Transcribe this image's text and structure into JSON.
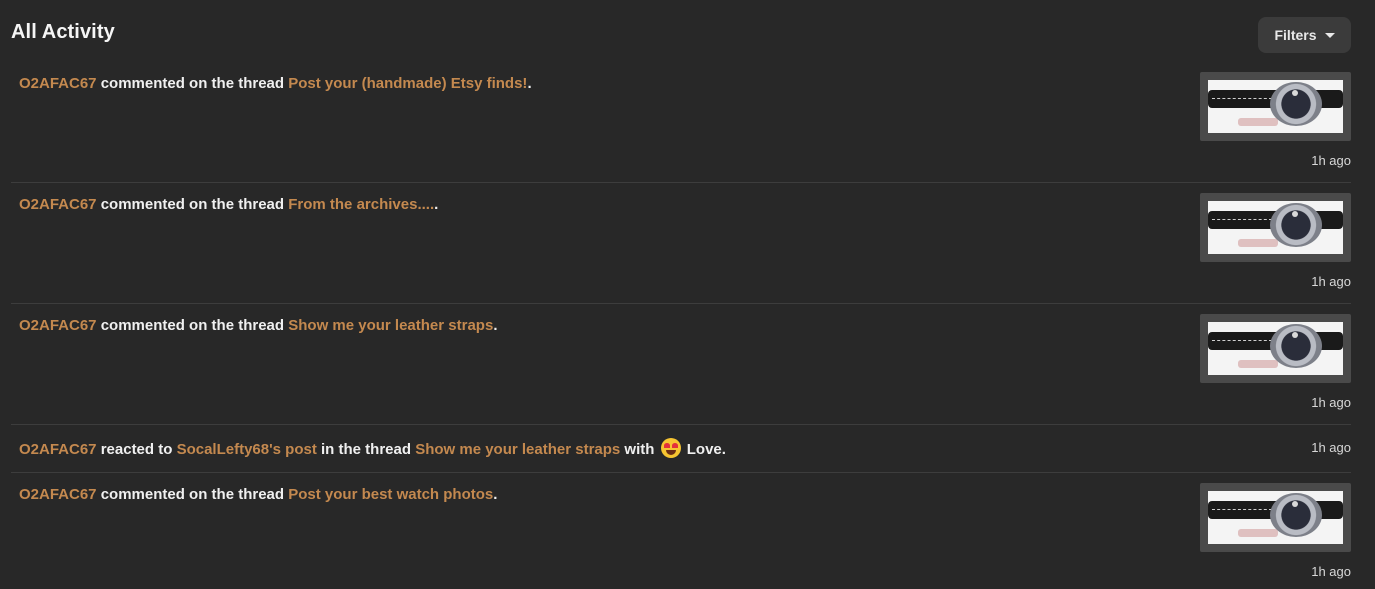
{
  "header": {
    "title": "All Activity",
    "filters_label": "Filters"
  },
  "activities": [
    {
      "user": "O2AFAC67",
      "action": " commented on the thread ",
      "thread": "Post your (handmade) Etsy finds!",
      "end": ".",
      "time": "1h ago",
      "thumbnail": "watch-thumbnail"
    },
    {
      "user": "O2AFAC67",
      "action": " commented on the thread ",
      "thread": "From the archives....",
      "end": ".",
      "time": "1h ago",
      "thumbnail": "watch-thumbnail"
    },
    {
      "user": "O2AFAC67",
      "action": " commented on the thread ",
      "thread": "Show me your leather straps",
      "end": ".",
      "time": "1h ago",
      "thumbnail": "watch-thumbnail"
    },
    {
      "user": "O2AFAC67",
      "action": " reacted to ",
      "post": "SocalLefty68's post",
      "middle": " in the thread ",
      "thread": "Show me your leather straps",
      "with": " with ",
      "reaction": "Love",
      "reaction_icon": "heart-eyes-emoji-icon",
      "end": ".",
      "time": "1h ago"
    },
    {
      "user": "O2AFAC67",
      "action": " commented on the thread ",
      "thread": "Post your best watch photos",
      "end": ".",
      "time": "1h ago",
      "thumbnail": "watch-thumbnail"
    }
  ],
  "colors": {
    "background": "#282828",
    "link": "#c4894f",
    "text": "#f0f0f0",
    "button": "#3b3b3b"
  }
}
